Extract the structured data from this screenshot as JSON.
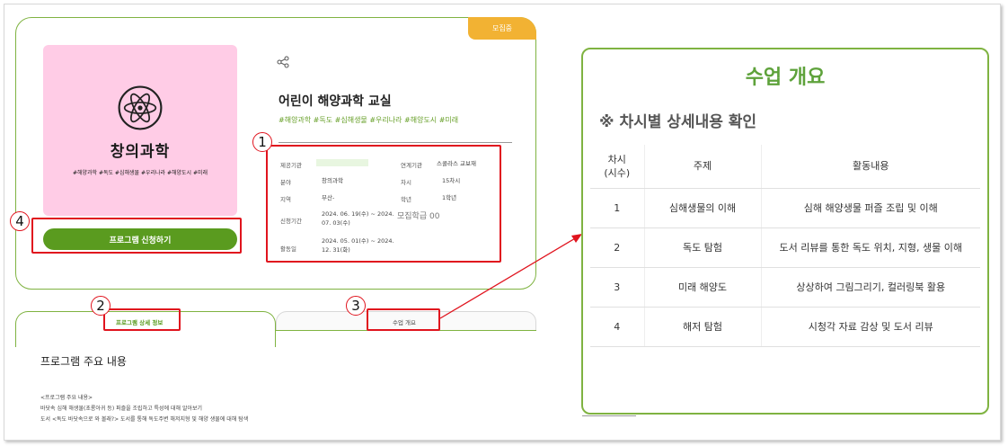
{
  "status_badge": "모집중",
  "thumbnail": {
    "title": "창의과학",
    "tags": "#해양과학 #독도 #심해생물 #우리나라 #해양도시 #미래"
  },
  "apply_button": "프로그램 신청하기",
  "program": {
    "title": "어린이 해양과학 교실",
    "tags": "#해양과학 #독도 #심해생물 #우리나라 #해양도시 #미래"
  },
  "info": {
    "provider_label": "제공기관",
    "partner_label": "연계기관",
    "partner_value": "스콜라스 교보재",
    "field_label": "분야",
    "field_value": "창의과학",
    "sessions_label": "차시",
    "sessions_value": "15차시",
    "region_label": "지역",
    "region_value": "부산-",
    "grade_label": "학년",
    "grade_value": "1학년",
    "apply_period_label": "신청기간",
    "apply_period_value_1": "2024. 06. 19(수) ~ 2024.",
    "apply_period_value_2": "07. 03(수)",
    "recruit_text": "모집학급 00",
    "activity_date_label": "활동일",
    "activity_date_value_1": "2024. 05. 01(수) ~ 2024.",
    "activity_date_value_2": "12. 31(화)"
  },
  "tabs": {
    "detail": "프로그램 상세 정보",
    "outline": "수업 개요"
  },
  "main": {
    "heading": "프로그램 주요 내용",
    "line1": "<프로그램 주요 내용>",
    "line2": "바닷속 심해 해생물(초롱아귀 등) 퍼즐을 조립하고 특성에 대해 알아보기",
    "line3": "도서 <독도 바닷속으로 와 볼래?> 도서를 통해 독도주변 해저지형 및 해양 생물에 대해 탐색"
  },
  "callouts": [
    "1",
    "2",
    "3",
    "4"
  ],
  "outline_panel": {
    "title": "수업 개요",
    "subtitle": "※ 차시별 상세내용 확인",
    "headers": [
      "차시\n(시수)",
      "주제",
      "활동내용"
    ],
    "rows": [
      [
        "1",
        "심해생물의 이해",
        "심해 해양생물 퍼즐 조립 및 이해"
      ],
      [
        "2",
        "독도 탐험",
        "도서 리뷰를 통한 독도 위치, 지형, 생물 이해"
      ],
      [
        "3",
        "미래 해양도",
        "상상하여 그림그리기, 컬러링북 활용"
      ],
      [
        "4",
        "해저 탐험",
        "시청각 자료 감상 및 도서 리뷰"
      ]
    ]
  },
  "colors": {
    "accent_green": "#5a9b1f",
    "badge_orange": "#f2b233",
    "callout_red": "#e0141e",
    "thumbnail_pink": "#ffcce6"
  }
}
